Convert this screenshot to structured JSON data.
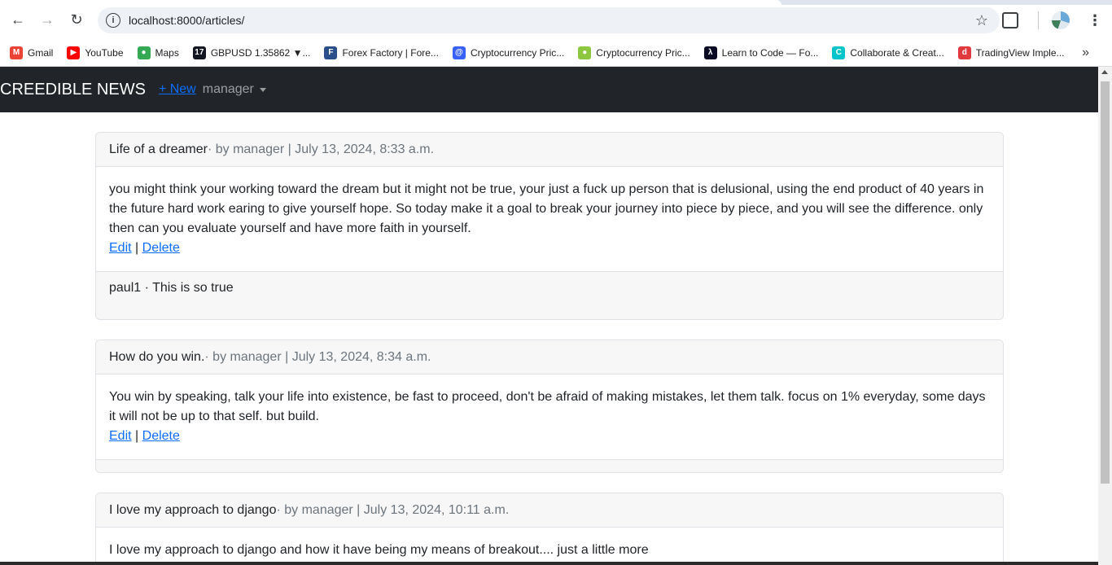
{
  "browser": {
    "url": "localhost:8000/articles/",
    "bookmarks": [
      {
        "label": "Gmail",
        "icon": "gmail-icon",
        "color": "#ea4335",
        "glyph": "M"
      },
      {
        "label": "YouTube",
        "icon": "youtube-icon",
        "color": "#ff0000",
        "glyph": "▶"
      },
      {
        "label": "Maps",
        "icon": "maps-icon",
        "color": "#34a853",
        "glyph": "●"
      },
      {
        "label": "GBPUSD 1.35862 ▼...",
        "icon": "tradingview-icon",
        "color": "#131722",
        "glyph": "17"
      },
      {
        "label": "Forex Factory | Fore...",
        "icon": "forex-factory-icon",
        "color": "#2a4f8a",
        "glyph": "F"
      },
      {
        "label": "Cryptocurrency Pric...",
        "icon": "coinmarketcap-icon",
        "color": "#3861fb",
        "glyph": "@"
      },
      {
        "label": "Cryptocurrency Pric...",
        "icon": "coingecko-icon",
        "color": "#8dc63f",
        "glyph": "●"
      },
      {
        "label": "Learn to Code — Fo...",
        "icon": "freecodecamp-icon",
        "color": "#0a0a23",
        "glyph": "λ"
      },
      {
        "label": "Collaborate & Creat...",
        "icon": "canva-icon",
        "color": "#00c4cc",
        "glyph": "C"
      },
      {
        "label": "TradingView Imple...",
        "icon": "tradingview-app-icon",
        "color": "#e03a3e",
        "glyph": "d"
      }
    ]
  },
  "navbar": {
    "brand": "CREEDIBLE NEWS",
    "new_link": "+ New",
    "user": "manager"
  },
  "articles": [
    {
      "title": "Life of a dreamer",
      "meta": " · by manager | July 13, 2024, 8:33 a.m.",
      "body": "you might think your working toward the dream but it might not be true, your just a fuck up person that is delusional, using the end product of 40 years in the future hard work earing to give yourself hope. So today make it a goal to break your journey into piece by piece, and you will see the difference. only then can you evaluate yourself and have more faith in yourself.",
      "edit": "Edit",
      "sep": "|",
      "delete": "Delete",
      "comment": "paul1 · This is so true"
    },
    {
      "title": "How do you win.",
      "meta": " · by manager | July 13, 2024, 8:34 a.m.",
      "body": "You win by speaking, talk your life into existence, be fast to proceed, don't be afraid of making mistakes, let them talk. focus on 1% everyday, some days it will not be up to that self. but build.",
      "edit": "Edit",
      "sep": "|",
      "delete": "Delete",
      "comment": ""
    },
    {
      "title": "I love my approach to django",
      "meta": " · by manager | July 13, 2024, 10:11 a.m.",
      "body": "I love my approach to django and how it have being my means of breakout.... just a little more"
    }
  ]
}
